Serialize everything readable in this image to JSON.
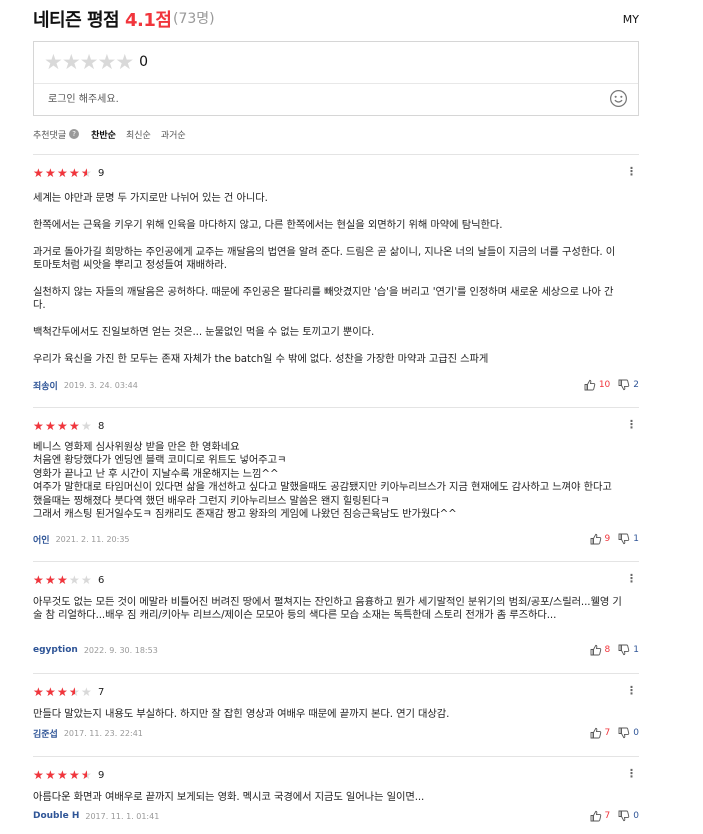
{
  "header": {
    "title": "네티즌 평점",
    "score": "4.1점",
    "count": "(73명)",
    "my": "MY"
  },
  "write_box": {
    "current_rating": "0",
    "placeholder": "로그인 해주세요.",
    "icon": "smile-icon"
  },
  "sort": {
    "recommended": "추천댓글",
    "help": "?",
    "options": [
      "찬반순",
      "최신순",
      "과거순"
    ],
    "active": "찬반순"
  },
  "colors": {
    "accent_red": "#f1353c",
    "user_blue": "#2f5597",
    "star_empty": "#d9d9d9"
  },
  "reviews": [
    {
      "rating": 9,
      "rating_text": "9",
      "body": "세계는 야만과 문명 두 가지로만 나뉘어 있는 건 아니다.\n\n한쪽에서는 근육을 키우기 위해 인육을 마다하지 않고, 다른 한쪽에서는 현실을 외면하기 위해 마약에 탐닉한다.\n\n과거로 돌아가길 희망하는 주인공에게 교주는 깨달음의 법연을 알려 준다. 드림은 곧 삶이니, 지나온 너의 날들이 지금의 너를 구성한다. 이 토마토처럼 씨앗을 뿌리고 정성들여 재배하라.\n\n실천하지 않는 자들의 깨달음은 공허하다. 때문에 주인공은 팔다리를 빼앗겼지만 '습'을 버리고 '연기'를 인정하며 새로운 세상으로 나아 간다.\n\n백척간두에서도 진일보하면 얻는 것은... 눈물없인 먹을 수 없는 토끼고기 뿐이다.\n\n우리가 육신을 가진 한 모두는 존재 자체가 the batch일 수 밖에 없다. 성찬을 가장한 마약과 고급진 스파게",
      "user": "죄송이",
      "date": "2019. 3. 24. 03:44",
      "likes": "10",
      "dislikes": "2"
    },
    {
      "rating": 8,
      "rating_text": "8",
      "body": "베니스 영화제 심사위원상 받을 만은 한 영화네요\n처음엔 황당했다가 엔딩엔 블랙 코미디로 위트도 넣어주고ㅋ\n영화가 끝나고 난 후 시간이 지날수록 개운해지는 느낌^^\n여주가 말한대로  타임머신이 있다면 삶을 개선하고 싶다고  말했을때도 공감됐지만  키아누리브스가  지금 현재에도 감사하고  느껴야 한다고 했을때는 찡해졌다  붓다역 했던 배우라 그런지  키아누리브스 말씀은  왠지 힐링된다ㅋ\n그래서 캐스팅 된거일수도ㅋ 짐캐리도 존재감 짱고  왕좌의 게임에 나왔던 짐승근육남도 반가웠다^^",
      "user": "어인",
      "date": "2021. 2. 11. 20:35",
      "likes": "9",
      "dislikes": "1"
    },
    {
      "rating": 6,
      "rating_text": "6",
      "body": "아무것도 없는 모든 것이 메말라 비틀어진 버려진 땅에서 펼쳐지는 잔인하고 음흉하고 뭔가 세기말적인 분위기의 범죄/공포/스릴러...웰영 기술 참 리얼하다...배우 짐 캐리/키아누 리브스/제이슨 모모아 등의 색다른 모습 소재는 독특한데 스토리 전개가 좀 루즈하다...",
      "user": "egyption",
      "date": "2022. 9. 30. 18:53",
      "likes": "8",
      "dislikes": "1"
    },
    {
      "rating": 7,
      "rating_text": "7",
      "body": "만들다 말았는지 내용도 부실하다. 하지만 잘 잡힌 영상과 여배우 때문에 끝까지 본다. 연기 대상감.",
      "user": "김준섭",
      "date": "2017. 11. 23. 22:41",
      "likes": "7",
      "dislikes": "0"
    },
    {
      "rating": 9,
      "rating_text": "9",
      "body": "아름다운 화면과 여배우로 끝까지 보게되는 영화. 멕시코 국경에서 지금도 일어나는 일이면...",
      "user": "Double H",
      "date": "2017. 11. 1. 01:41",
      "likes": "7",
      "dislikes": "0"
    }
  ]
}
